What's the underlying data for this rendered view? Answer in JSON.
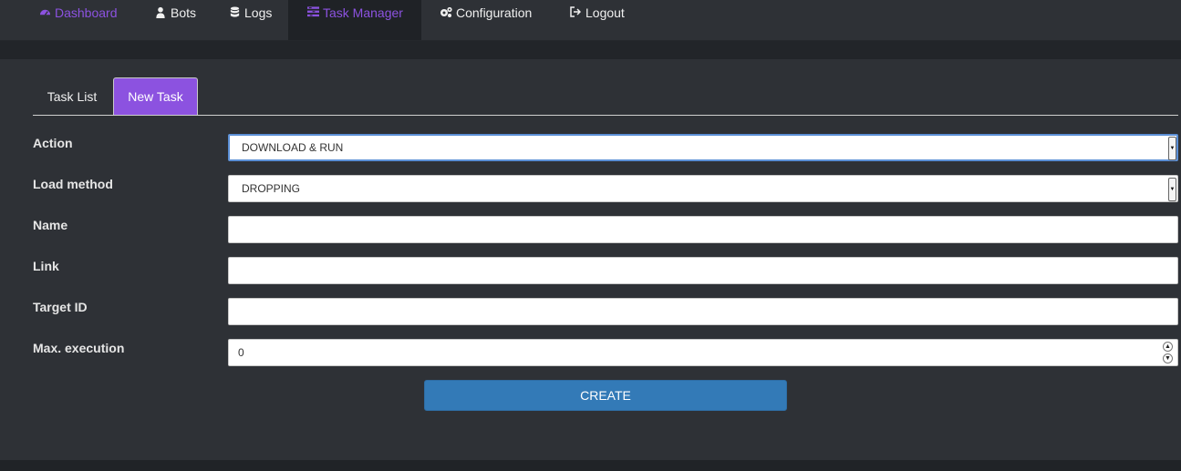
{
  "nav": {
    "items": [
      {
        "label": "Dashboard",
        "icon": "dashboard-icon"
      },
      {
        "label": "Bots",
        "icon": "user-icon"
      },
      {
        "label": "Logs",
        "icon": "database-icon"
      },
      {
        "label": "Task Manager",
        "icon": "tasks-icon"
      },
      {
        "label": "Configuration",
        "icon": "gears-icon"
      },
      {
        "label": "Logout",
        "icon": "sign-out-icon"
      }
    ],
    "active": "Task Manager",
    "accent_color": "#8c52e0"
  },
  "tabs": [
    {
      "label": "Task List"
    },
    {
      "label": "New Task"
    }
  ],
  "active_tab": "New Task",
  "form": {
    "action": {
      "label": "Action",
      "value": "DOWNLOAD & RUN"
    },
    "load_method": {
      "label": "Load method",
      "value": "DROPPING"
    },
    "name": {
      "label": "Name",
      "value": ""
    },
    "link": {
      "label": "Link",
      "value": ""
    },
    "target_id": {
      "label": "Target ID",
      "value": ""
    },
    "max_execution": {
      "label": "Max. execution",
      "value": "0"
    },
    "submit_label": "CREATE"
  },
  "colors": {
    "background": "#2e3136",
    "active_tab": "#8c52e0",
    "button": "#337ab7"
  }
}
